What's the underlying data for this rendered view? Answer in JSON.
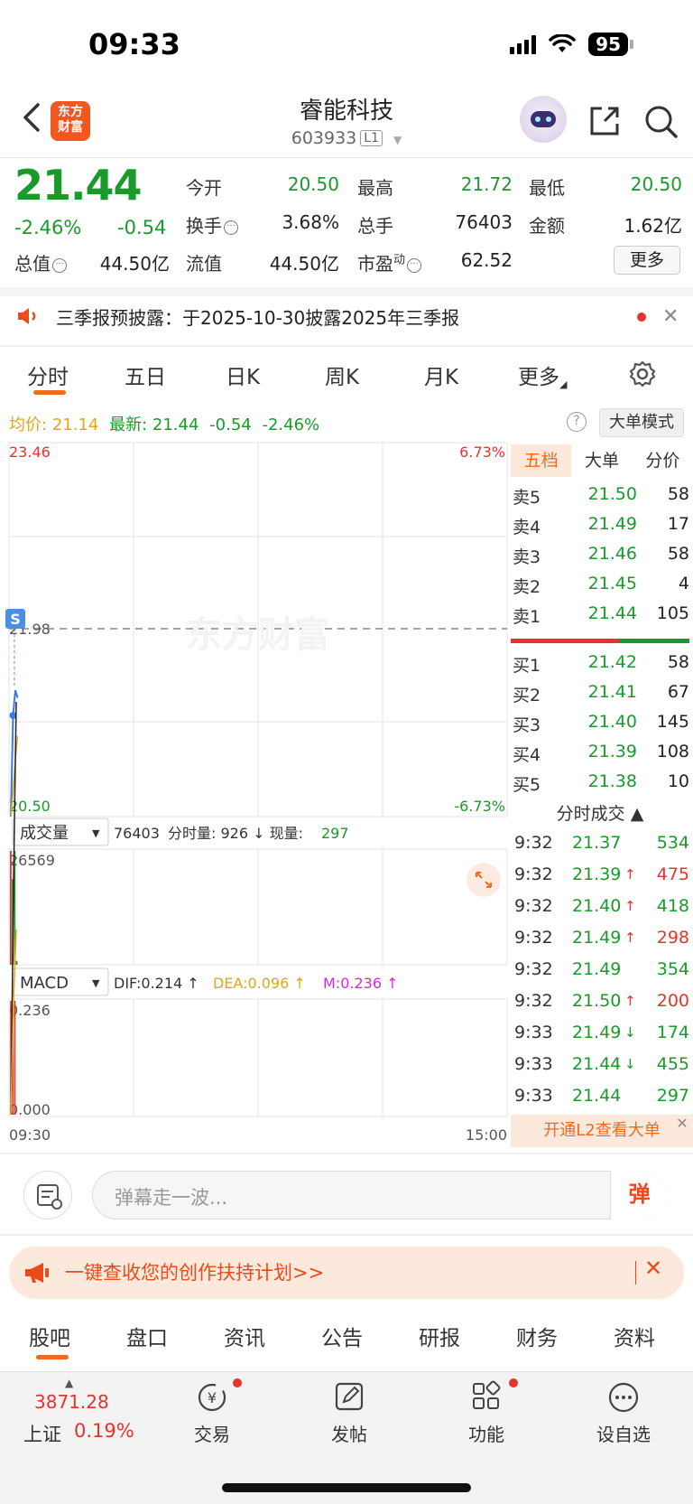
{
  "status_bar": {
    "time": "09:33",
    "battery": "95"
  },
  "header": {
    "logo_text_1": "东方",
    "logo_text_2": "财富",
    "stock_name": "睿能科技",
    "stock_code": "603933",
    "code_badge": "L1"
  },
  "quote": {
    "price": "21.44",
    "change_pct": "-2.46%",
    "change_amt": "-0.54",
    "fields": {
      "open_label": "今开",
      "open": "20.50",
      "high_label": "最高",
      "high": "21.72",
      "low_label": "最低",
      "low": "20.50",
      "turnover_label": "换手",
      "turnover": "3.68%",
      "volume_label": "总手",
      "volume": "76403",
      "amount_label": "金额",
      "amount": "1.62亿",
      "mktcap_label": "总值",
      "mktcap": "44.50亿",
      "float_label": "流值",
      "float": "44.50亿",
      "pe_label": "市盈",
      "pe_sup": "动",
      "pe": "62.52"
    },
    "more_label": "更多"
  },
  "notice": {
    "text": "三季报预披露：于2025-10-30披露2025年三季报",
    "close": "✕"
  },
  "chart_tabs": [
    "分时",
    "五日",
    "日K",
    "周K",
    "月K",
    "更多"
  ],
  "chart_info": {
    "avg_label": "均价:",
    "avg": "21.14",
    "latest_label": "最新:",
    "latest": "21.44",
    "latest_chg": "-0.54",
    "latest_pct": "-2.46%",
    "help": "?",
    "big_order_mode": "大单模式"
  },
  "chart_labels": {
    "price_top": "23.46",
    "pct_top": "6.73%",
    "prev_close": "21.98",
    "price_bottom": "20.50",
    "pct_bottom": "-6.73%",
    "watermark": "东方财富",
    "s_marker": "S",
    "vol_selector": "成交量",
    "vol_info_total": "76403",
    "vol_info_rest": "分时量: 926 ↓ 现量:",
    "vol_now": "297",
    "vol_max": "26569",
    "macd_selector": "MACD",
    "dif": "DIF:0.214 ↑",
    "dea": "DEA:0.096 ↑",
    "m": "M:0.236 ↑",
    "macd_max": "0.236",
    "macd_zero": "0.000",
    "time_start": "09:30",
    "time_end": "15:00"
  },
  "chart_data": {
    "type": "line",
    "title": "",
    "xlabel": "",
    "ylabel": "",
    "ylim": [
      20.5,
      23.46
    ],
    "prev_close": 21.98,
    "x": [
      "09:30",
      "09:31",
      "09:32",
      "09:33"
    ],
    "series": [
      {
        "values": [
          20.5,
          21.3,
          21.5,
          21.44
        ]
      },
      {
        "values": [
          20.5,
          20.7,
          20.95,
          21.14
        ]
      }
    ],
    "volume": {
      "ylim": [
        0,
        26569
      ],
      "values": [
        26569,
        20000,
        26569,
        926
      ]
    },
    "macd": {
      "ylim": [
        0,
        0.236
      ],
      "dif": [
        0.0,
        0.12,
        0.214
      ],
      "dea": [
        0.0,
        0.06,
        0.096
      ],
      "m": [
        0.236,
        0.2,
        0.236
      ]
    }
  },
  "order_book": {
    "tabs": [
      "五档",
      "大单",
      "分价"
    ],
    "asks": [
      {
        "label": "卖5",
        "price": "21.50",
        "vol": "58"
      },
      {
        "label": "卖4",
        "price": "21.49",
        "vol": "17"
      },
      {
        "label": "卖3",
        "price": "21.46",
        "vol": "58"
      },
      {
        "label": "卖2",
        "price": "21.45",
        "vol": "4"
      },
      {
        "label": "卖1",
        "price": "21.44",
        "vol": "105"
      }
    ],
    "bids": [
      {
        "label": "买1",
        "price": "21.42",
        "vol": "58"
      },
      {
        "label": "买2",
        "price": "21.41",
        "vol": "67"
      },
      {
        "label": "买3",
        "price": "21.40",
        "vol": "145"
      },
      {
        "label": "买4",
        "price": "21.39",
        "vol": "108"
      },
      {
        "label": "买5",
        "price": "21.38",
        "vol": "10"
      }
    ],
    "ticks_title": "分时成交 ▲",
    "ticks": [
      {
        "t": "9:32",
        "p": "21.37",
        "arr": "",
        "v": "534",
        "pc": "green",
        "vc": "green"
      },
      {
        "t": "9:32",
        "p": "21.39",
        "arr": "↑",
        "v": "475",
        "pc": "green",
        "vc": "red"
      },
      {
        "t": "9:32",
        "p": "21.40",
        "arr": "↑",
        "v": "418",
        "pc": "green",
        "vc": "green"
      },
      {
        "t": "9:32",
        "p": "21.49",
        "arr": "↑",
        "v": "298",
        "pc": "green",
        "vc": "red"
      },
      {
        "t": "9:32",
        "p": "21.49",
        "arr": "",
        "v": "354",
        "pc": "green",
        "vc": "green"
      },
      {
        "t": "9:32",
        "p": "21.50",
        "arr": "↑",
        "v": "200",
        "pc": "green",
        "vc": "red"
      },
      {
        "t": "9:33",
        "p": "21.49",
        "arr": "↓",
        "v": "174",
        "pc": "green",
        "vc": "green"
      },
      {
        "t": "9:33",
        "p": "21.44",
        "arr": "↓",
        "v": "455",
        "pc": "green",
        "vc": "green"
      },
      {
        "t": "9:33",
        "p": "21.44",
        "arr": "",
        "v": "297",
        "pc": "green",
        "vc": "green"
      }
    ],
    "l2_banner": "开通L2查看大单",
    "l2_close": "✕"
  },
  "danmaku": {
    "placeholder": "弹幕走一波...",
    "button": "弹"
  },
  "promo": {
    "text": "一键查收您的创作扶持计划>>",
    "close": "✕"
  },
  "bottom_tabs": [
    "股吧",
    "盘口",
    "资讯",
    "公告",
    "研报",
    "财务",
    "资料"
  ],
  "bottom_nav": {
    "index_value": "3871.28",
    "index_name": "上证",
    "index_change": "0.19%",
    "trade": "交易",
    "post": "发帖",
    "func": "功能",
    "watch": "设自选"
  },
  "colors": {
    "up": "#e8322c",
    "down": "#1a9a2a",
    "accent": "#ee6c21"
  }
}
